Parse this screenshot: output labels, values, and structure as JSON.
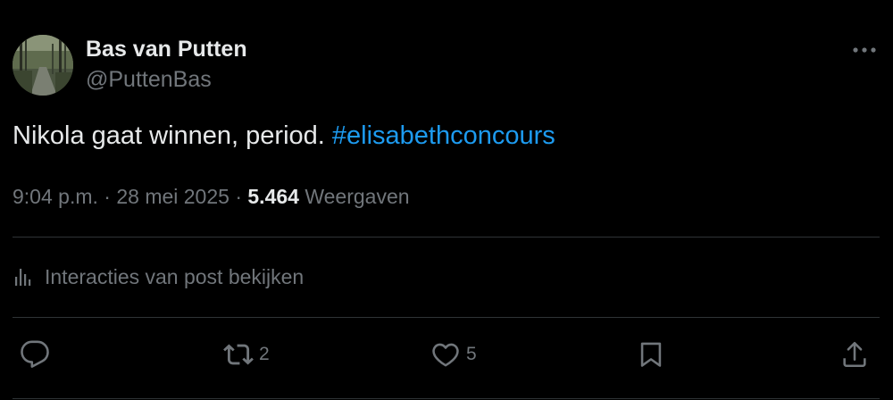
{
  "author": {
    "name": "Bas van Putten",
    "handle": "@PuttenBas"
  },
  "post": {
    "text": "Nikola gaat winnen, period. ",
    "hashtag": "#elisabethconcours"
  },
  "meta": {
    "time": "9:04 p.m.",
    "separator1": " · ",
    "date": "28 mei 2025",
    "separator2": " · ",
    "views_count": "5.464",
    "views_label": "Weergaven"
  },
  "interactions_link": "Interacties van post bekijken",
  "actions": {
    "reply_count": "",
    "retweet_count": "2",
    "like_count": "5"
  },
  "colors": {
    "background": "#000000",
    "text": "#e7e9ea",
    "secondary": "#71767b",
    "accent": "#1d9bf0",
    "divider": "#2f3336"
  },
  "icons": [
    "more-icon",
    "analytics-icon",
    "reply-icon",
    "retweet-icon",
    "like-icon",
    "bookmark-icon",
    "share-icon"
  ]
}
